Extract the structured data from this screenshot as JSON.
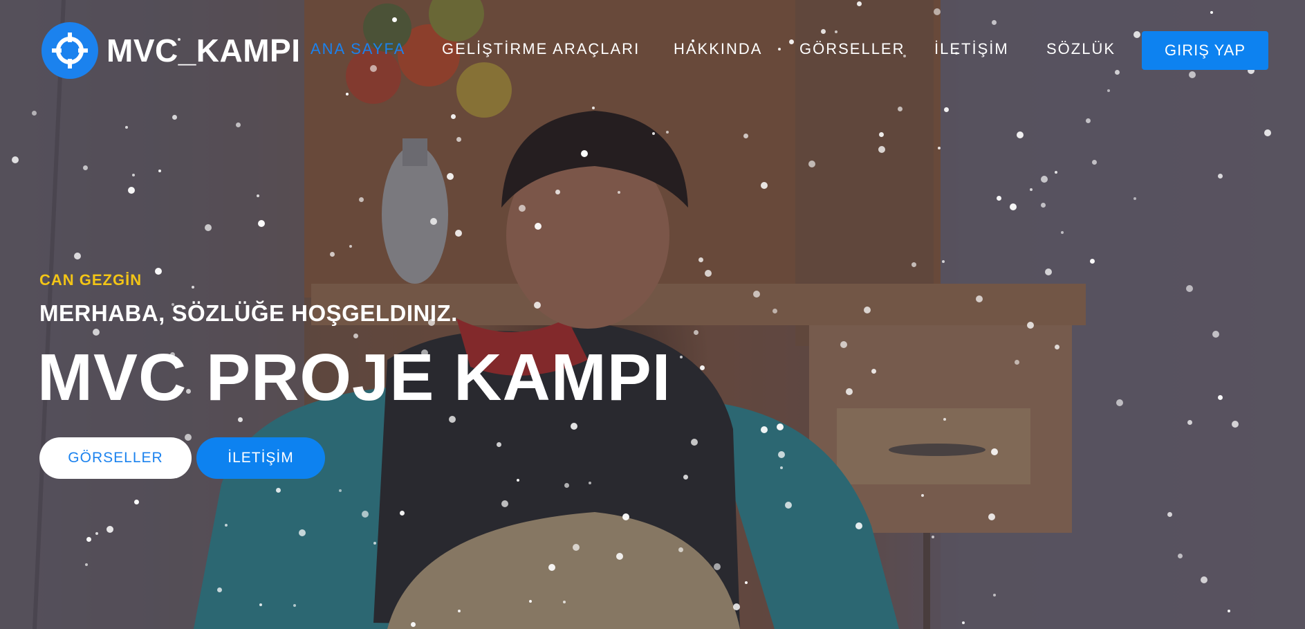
{
  "brand": {
    "name": "MVC_KAMPI",
    "icon": "crosshair-icon",
    "color": "#1b82ee"
  },
  "nav": {
    "items": [
      {
        "label": "ANA SAYFA",
        "active": true
      },
      {
        "label": "GELİŞTİRME ARAÇLARI"
      },
      {
        "label": "HAKKINDA"
      },
      {
        "label": "GÖRSELLER"
      },
      {
        "label": "İLETİŞİM"
      },
      {
        "label": "SÖZLÜK"
      }
    ],
    "login_label": "GIRIŞ YAP"
  },
  "hero": {
    "eyebrow": "CAN GEZGİN",
    "subtitle": "MERHABA, SÖZLÜĞE HOŞGELDINIZ.",
    "title": "MVC PROJE KAMPI",
    "buttons": {
      "primary": "GÖRSELLER",
      "secondary": "İLETİŞİM"
    }
  },
  "colors": {
    "accent": "#1b82ee",
    "eyebrow": "#f3c516"
  }
}
